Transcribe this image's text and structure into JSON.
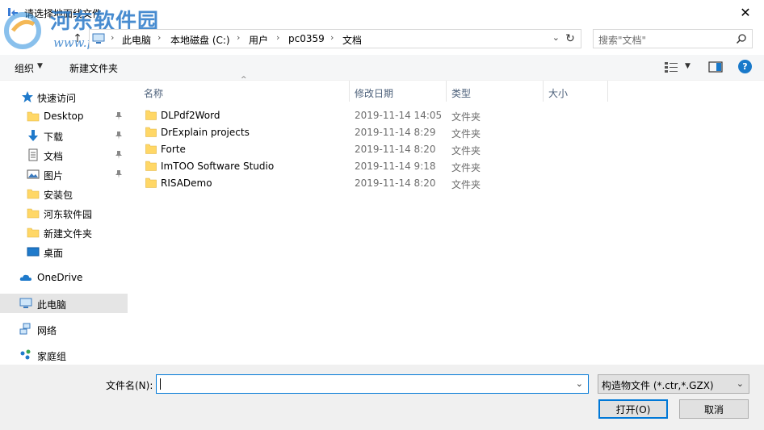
{
  "titlebar": {
    "title": "请选择地面线文件",
    "close_glyph": "✕"
  },
  "watermark": {
    "name": "河东软件园",
    "url": "www.pc0359.cn"
  },
  "address": {
    "crumbs": [
      "此电脑",
      "本地磁盘 (C:)",
      "用户",
      "pc0359",
      "文档"
    ],
    "separator": "›",
    "dropdown_glyph": "⌄",
    "refresh_glyph": "↻",
    "up_glyph": "↑"
  },
  "search": {
    "placeholder": "搜索\"文档\""
  },
  "commandbar": {
    "organize": "组织",
    "new_folder": "新建文件夹",
    "dropdown_glyph": "▼",
    "help_glyph": "?"
  },
  "sidebar": {
    "quick_access": "快速访问",
    "items": [
      {
        "label": "Desktop",
        "icon": "folder-icon",
        "pinned": true
      },
      {
        "label": "下载",
        "icon": "download-icon",
        "pinned": true
      },
      {
        "label": "文档",
        "icon": "document-icon",
        "pinned": true
      },
      {
        "label": "图片",
        "icon": "picture-icon",
        "pinned": true
      },
      {
        "label": "安装包",
        "icon": "folder-icon",
        "pinned": false
      },
      {
        "label": "河东软件园",
        "icon": "folder-icon",
        "pinned": false
      },
      {
        "label": "新建文件夹",
        "icon": "folder-icon",
        "pinned": false
      },
      {
        "label": "桌面",
        "icon": "desktop-icon",
        "pinned": false
      }
    ],
    "onedrive": "OneDrive",
    "this_pc": "此电脑",
    "network": "网络",
    "homegroup": "家庭组"
  },
  "filelist": {
    "columns": {
      "name": "名称",
      "date": "修改日期",
      "type": "类型",
      "size": "大小"
    },
    "sort_glyph": "^",
    "rows": [
      {
        "name": "DLPdf2Word",
        "date": "2019-11-14 14:05",
        "type": "文件夹"
      },
      {
        "name": "DrExplain projects",
        "date": "2019-11-14 8:29",
        "type": "文件夹"
      },
      {
        "name": "Forte",
        "date": "2019-11-14 8:20",
        "type": "文件夹"
      },
      {
        "name": "ImTOO Software Studio",
        "date": "2019-11-14 9:18",
        "type": "文件夹"
      },
      {
        "name": "RISADemo",
        "date": "2019-11-14 8:20",
        "type": "文件夹"
      }
    ]
  },
  "bottom": {
    "filename_label": "文件名(N):",
    "filename_value": "",
    "filetype_value": "构造物文件 (*.ctr,*.GZX)",
    "dropdown_glyph": "⌄",
    "open_label": "打开(O)",
    "cancel_label": "取消"
  },
  "colors": {
    "accent": "#0078d7",
    "selected": "#cce8ff",
    "folder": "#ffd766",
    "header_text": "#4c607a",
    "muted": "#6d6d6d"
  }
}
